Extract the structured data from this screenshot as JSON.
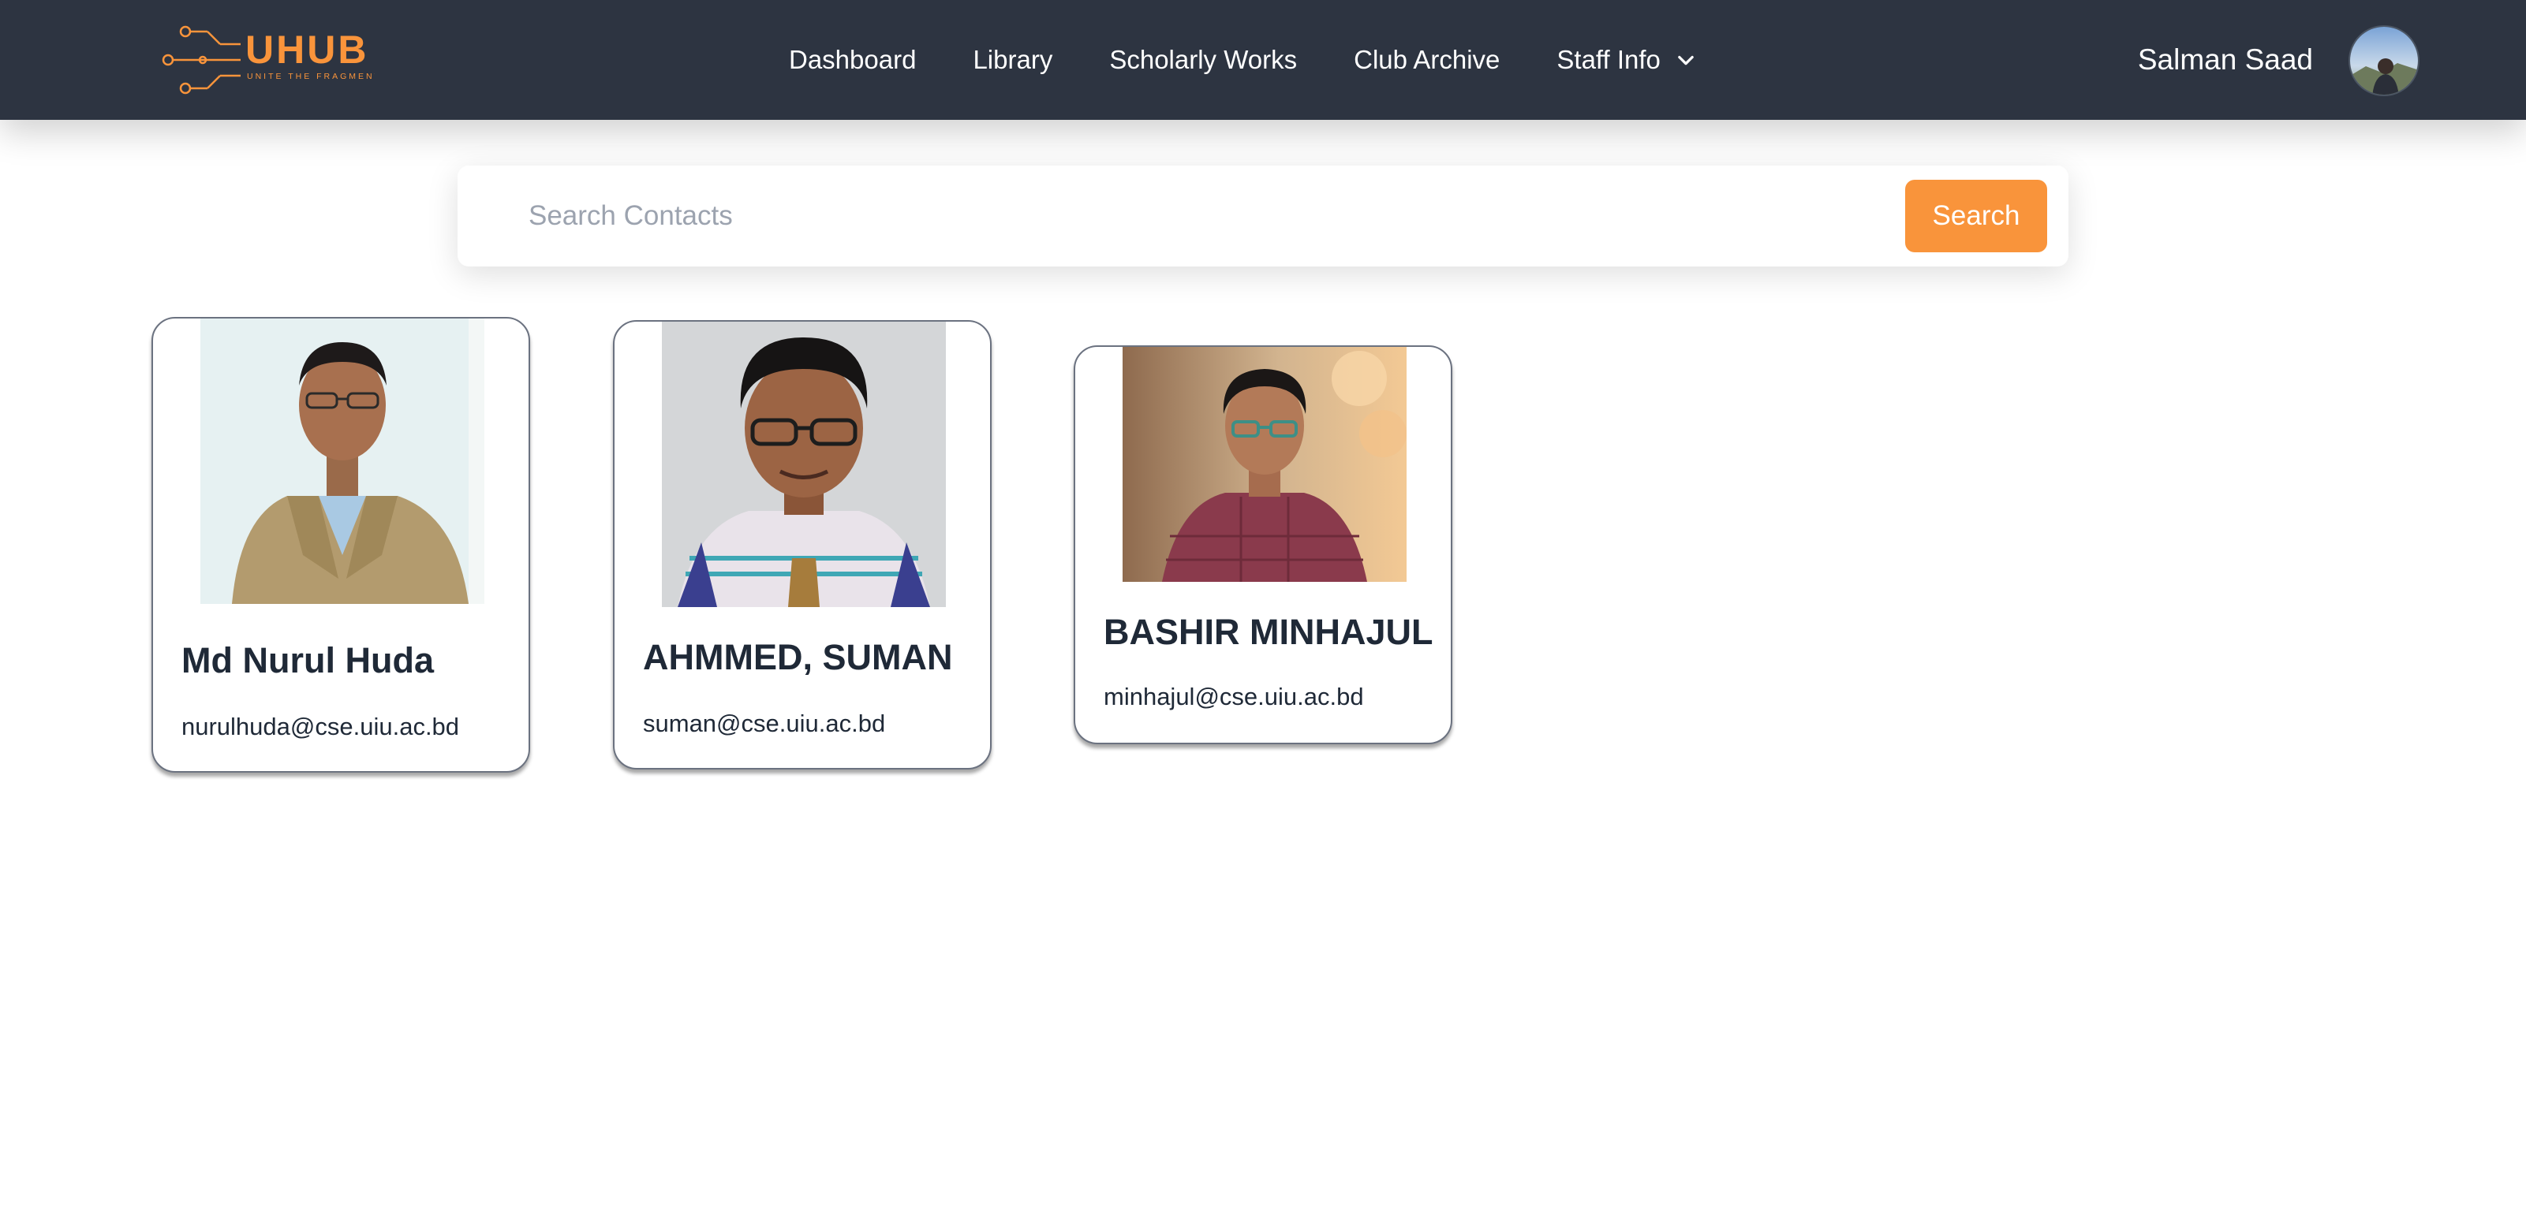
{
  "brand": {
    "name": "UHUB",
    "tagline": "UNITE THE FRAGMENTS",
    "color": "#f9943b"
  },
  "nav": {
    "links": [
      "Dashboard",
      "Library",
      "Scholarly Works",
      "Club Archive",
      "Staff Info"
    ],
    "dropdown_icon": "chevron-down-icon"
  },
  "user": {
    "name": "Salman Saad"
  },
  "search": {
    "placeholder": "Search Contacts",
    "value": "",
    "button_label": "Search"
  },
  "contacts": [
    {
      "name": "Md Nurul Huda",
      "email": "nurulhuda@cse.uiu.ac.bd"
    },
    {
      "name": "AHMMED, SUMAN",
      "email": "suman@cse.uiu.ac.bd"
    },
    {
      "name": "BASHIR MINHAJUL",
      "email": "minhajul@cse.uiu.ac.bd"
    }
  ],
  "colors": {
    "navbar": "#2d3441",
    "accent": "#f9943b",
    "card_border": "#6b7280"
  }
}
